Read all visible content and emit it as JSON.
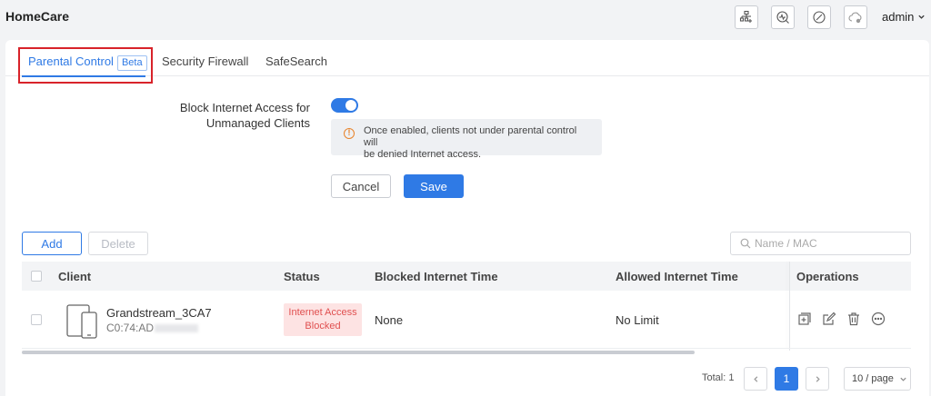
{
  "app": {
    "title": "HomeCare",
    "user": "admin"
  },
  "header_icons": [
    "network-topology-icon",
    "diagnostics-icon",
    "compass-icon",
    "cloud-settings-icon"
  ],
  "tabs": [
    {
      "label": "Parental Control",
      "badge": "Beta",
      "active": true
    },
    {
      "label": "Security Firewall",
      "active": false
    },
    {
      "label": "SafeSearch",
      "active": false
    }
  ],
  "settings": {
    "block_label_line1": "Block Internet Access for",
    "block_label_line2": "Unmanaged Clients",
    "toggle_on": true,
    "notice_line1": "Once enabled, clients not under parental control will",
    "notice_line2": "be denied Internet access.",
    "cancel_label": "Cancel",
    "save_label": "Save"
  },
  "toolbar": {
    "add_label": "Add",
    "delete_label": "Delete",
    "search_placeholder": "Name / MAC"
  },
  "table": {
    "columns": [
      "Client",
      "Status",
      "Blocked Internet Time",
      "Allowed Internet Time",
      "Operations"
    ],
    "rows": [
      {
        "client_name": "Grandstream_3CA7",
        "client_mac": "C0:74:AD",
        "status_line1": "Internet Access",
        "status_line2": "Blocked",
        "blocked_time": "None",
        "allowed_time": "No Limit"
      }
    ]
  },
  "pagination": {
    "total": "Total: 1",
    "current_page": "1",
    "page_size": "10 / page"
  },
  "colors": {
    "accent": "#2f7ae5",
    "status_blocked_bg": "#fde3e3",
    "status_blocked_text": "#e05050",
    "highlight": "#d8232a",
    "warning": "#e8832a"
  }
}
